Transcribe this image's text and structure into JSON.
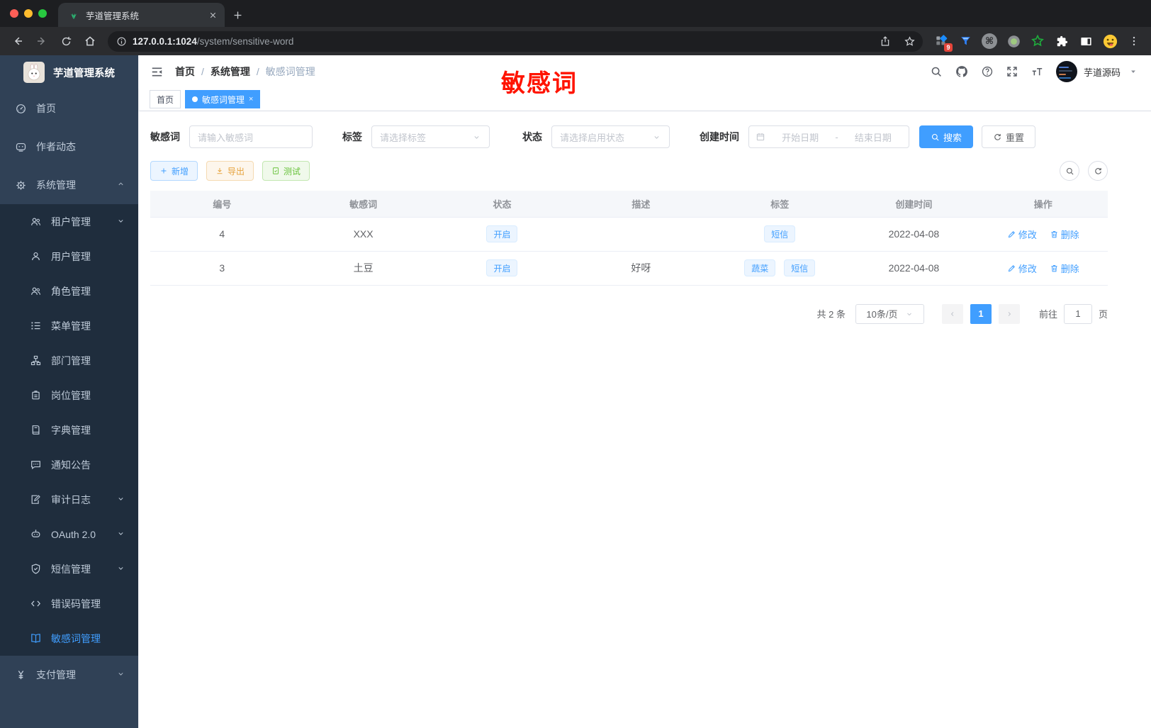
{
  "browser": {
    "tab_title": "芋道管理系统",
    "url_host": "127.0.0.1:1024",
    "url_path": "/system/sensitive-word",
    "extension_badge": "9",
    "command_glyph": "⌘"
  },
  "sidebar": {
    "logo_title": "芋道管理系统",
    "top": [
      {
        "label": "首页",
        "icon": "dashboard-icon"
      },
      {
        "label": "作者动态",
        "icon": "chat-icon"
      },
      {
        "label": "系统管理",
        "icon": "gear-icon",
        "chevron": "up"
      }
    ],
    "sub": [
      {
        "label": "租户管理",
        "icon": "users-icon",
        "chevron": "down"
      },
      {
        "label": "用户管理",
        "icon": "user-icon"
      },
      {
        "label": "角色管理",
        "icon": "users-icon"
      },
      {
        "label": "菜单管理",
        "icon": "tree-list-icon"
      },
      {
        "label": "部门管理",
        "icon": "org-icon"
      },
      {
        "label": "岗位管理",
        "icon": "badge-icon"
      },
      {
        "label": "字典管理",
        "icon": "book-icon"
      },
      {
        "label": "通知公告",
        "icon": "message-icon"
      },
      {
        "label": "审计日志",
        "icon": "edit-doc-icon",
        "chevron": "down"
      },
      {
        "label": "OAuth 2.0",
        "icon": "robot-icon",
        "chevron": "down"
      },
      {
        "label": "短信管理",
        "icon": "shield-icon",
        "chevron": "down"
      },
      {
        "label": "错误码管理",
        "icon": "code-icon"
      },
      {
        "label": "敏感词管理",
        "icon": "open-book-icon",
        "active": true
      }
    ],
    "bottom": [
      {
        "label": "支付管理",
        "icon": "yen-icon",
        "chevron": "down"
      }
    ]
  },
  "header": {
    "breadcrumb": {
      "c1": "首页",
      "c2": "系统管理",
      "c3": "敏感词管理",
      "sep": "/"
    },
    "annotation": "敏感词",
    "user_name": "芋道源码"
  },
  "tagsbar": {
    "tab_home": "首页",
    "tab_active": "敏感词管理",
    "close_glyph": "×"
  },
  "filters": {
    "keyword_label": "敏感词",
    "keyword_placeholder": "请输入敏感词",
    "tag_label": "标签",
    "tag_placeholder": "请选择标签",
    "status_label": "状态",
    "status_placeholder": "请选择启用状态",
    "date_label": "创建时间",
    "date_start_placeholder": "开始日期",
    "date_separator": "-",
    "date_end_placeholder": "结束日期",
    "search_label": "搜索",
    "reset_label": "重置"
  },
  "actions": {
    "add_label": "新增",
    "export_label": "导出",
    "test_label": "测试"
  },
  "table": {
    "columns": {
      "c0": "编号",
      "c1": "敏感词",
      "c2": "状态",
      "c3": "描述",
      "c4": "标签",
      "c5": "创建时间",
      "c6": "操作"
    },
    "rows": [
      {
        "id": "4",
        "word": "XXX",
        "status": "开启",
        "desc": "",
        "tags": [
          "短信"
        ],
        "created": "2022-04-08",
        "edit": "修改",
        "delete": "删除"
      },
      {
        "id": "3",
        "word": "土豆",
        "status": "开启",
        "desc": "好呀",
        "tags": [
          "蔬菜",
          "短信"
        ],
        "created": "2022-04-08",
        "edit": "修改",
        "delete": "删除"
      }
    ]
  },
  "pagination": {
    "total": "共 2 条",
    "page_size": "10条/页",
    "current_page": "1",
    "goto_label": "前往",
    "goto_value": "1",
    "page_unit": "页"
  },
  "colors": {
    "accent": "#409eff",
    "sidebar_bg": "#304156",
    "submenu_bg": "#1f2d3d",
    "annotation_red": "#ff1400",
    "warning": "#e6a23c",
    "success": "#67c23a"
  }
}
